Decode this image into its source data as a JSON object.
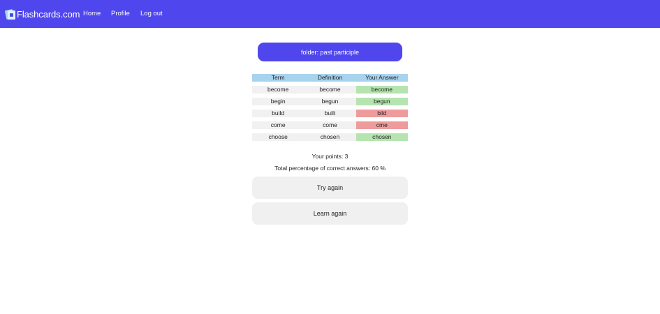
{
  "nav": {
    "brand": "Flashcards.com",
    "links": [
      "Home",
      "Profile",
      "Log out"
    ]
  },
  "folder": {
    "label": "folder: past participle"
  },
  "table": {
    "headers": [
      "Term",
      "Definition",
      "Your Answer"
    ],
    "rows": [
      {
        "term": "become",
        "definition": "become",
        "answer": "become",
        "status": "correct"
      },
      {
        "term": "begin",
        "definition": "begun",
        "answer": "begun",
        "status": "correct"
      },
      {
        "term": "build",
        "definition": "built",
        "answer": "bild",
        "status": "wrong"
      },
      {
        "term": "come",
        "definition": "come",
        "answer": "cme",
        "status": "wrong"
      },
      {
        "term": "choose",
        "definition": "chosen",
        "answer": "chosen",
        "status": "correct"
      }
    ]
  },
  "summary": {
    "points": "Your points: 3",
    "percentage": "Total percentage of correct answers: 60 %"
  },
  "buttons": {
    "try_again": "Try again",
    "learn_again": "Learn again"
  },
  "colors": {
    "accent": "#4f46ee",
    "header_bg": "#a8d3ee",
    "correct": "#b6e4b0",
    "wrong": "#ee9b9b",
    "cell_bg": "#f1f1f1"
  }
}
